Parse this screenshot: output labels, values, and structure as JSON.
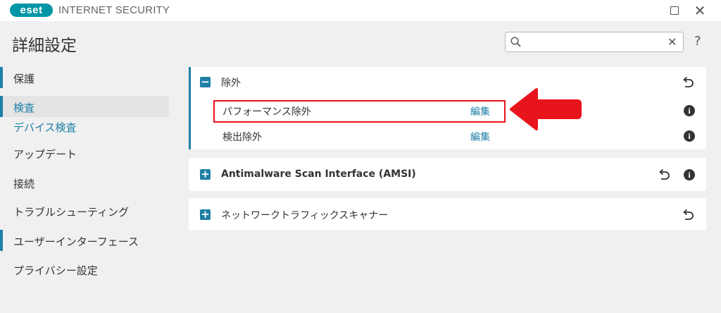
{
  "titlebar": {
    "logo_text": "eset",
    "product_name": "INTERNET SECURITY",
    "maximize_icon": "maximize-icon",
    "close_icon": "close-icon",
    "close_glyph": "✕"
  },
  "header": {
    "title": "詳細設定",
    "search": {
      "placeholder": "",
      "value": "",
      "clear_glyph": "✕"
    },
    "help": "?"
  },
  "sidebar": {
    "items": [
      {
        "label": "保護",
        "marked": true
      },
      {
        "label": "検査",
        "active": true
      },
      {
        "label": "デバイス検査",
        "sub": true
      },
      {
        "label": "アップデート"
      },
      {
        "label": "接続"
      },
      {
        "label": "トラブルシューティング"
      },
      {
        "label": "ユーザーインターフェース",
        "marked": true
      },
      {
        "label": "プライバシー設定"
      }
    ]
  },
  "panels": [
    {
      "title": "除外",
      "expanded": true,
      "toggle": "−",
      "rows": [
        {
          "label": "パフォーマンス除外",
          "link": "編集",
          "info": "i"
        },
        {
          "label": "検出除外",
          "link": "編集",
          "info": "i"
        }
      ]
    },
    {
      "title": "Antimalware Scan Interface (AMSI)",
      "expanded": false,
      "toggle": "+",
      "info": "i"
    },
    {
      "title": "ネットワークトラフィックスキャナー",
      "expanded": false,
      "toggle": "+"
    }
  ],
  "colors": {
    "accent": "#1e7fa6",
    "highlight": "#e8141c",
    "logo": "#0096a6"
  }
}
